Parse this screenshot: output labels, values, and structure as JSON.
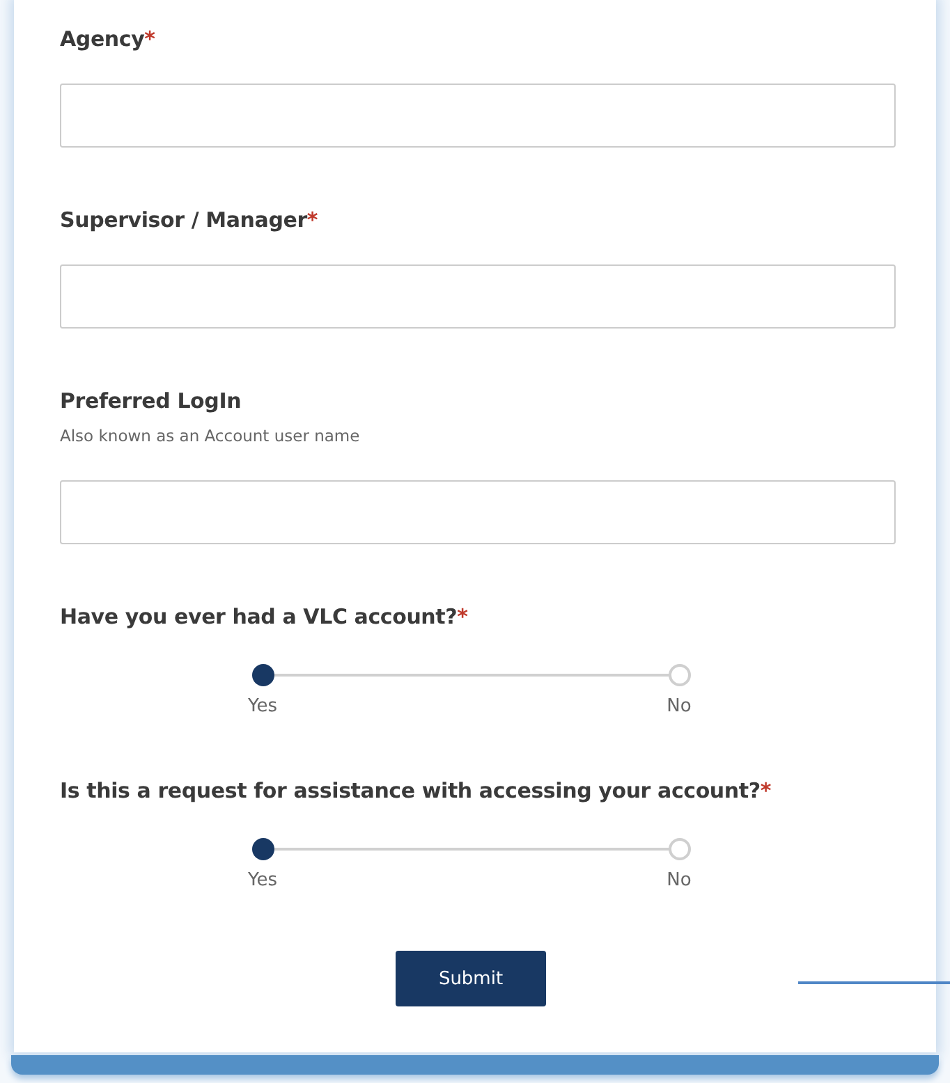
{
  "fields": [
    {
      "kind": "text",
      "label": "Agency",
      "required_mark": "*"
    },
    {
      "kind": "text",
      "label": "Supervisor / Manager",
      "required_mark": "*"
    },
    {
      "kind": "text",
      "label": "Preferred LogIn",
      "hint": "Also known as an Account user name"
    },
    {
      "kind": "choice",
      "label": "Have you ever had a VLC account?",
      "required_mark": "*",
      "options": [
        {
          "label": "Yes",
          "selected": true
        },
        {
          "label": "No",
          "selected": false
        }
      ]
    },
    {
      "kind": "choice",
      "label": "Is this a request for assistance with accessing your account?",
      "required_mark": "*",
      "options": [
        {
          "label": "Yes",
          "selected": true
        },
        {
          "label": "No",
          "selected": false
        }
      ]
    }
  ],
  "submit": "Submit"
}
